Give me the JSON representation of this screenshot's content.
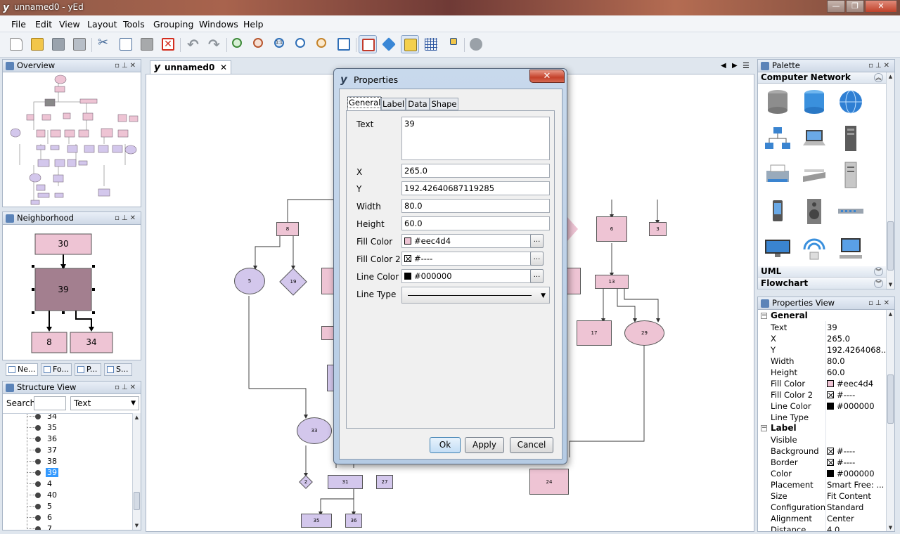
{
  "window": {
    "title": "unnamed0 - yEd"
  },
  "menu": [
    "File",
    "Edit",
    "View",
    "Layout",
    "Tools",
    "Grouping",
    "Windows",
    "Help"
  ],
  "toolbar": {
    "icons": [
      "new-document",
      "open",
      "save",
      "save-as",
      "cut",
      "copy",
      "paste",
      "delete",
      "undo",
      "redo",
      "zoom-in",
      "zoom-out",
      "zoom-100",
      "zoom-fit",
      "zoom-area",
      "fit-content",
      "edit-mode",
      "navigation-mode",
      "snapping",
      "grid",
      "orthogonal-edges",
      "plugin"
    ]
  },
  "panels": {
    "overview": {
      "title": "Overview"
    },
    "neighborhood": {
      "title": "Neighborhood",
      "nodes": {
        "top": "30",
        "center": "39",
        "bottom_left": "8",
        "bottom_right": "34"
      }
    },
    "tabs": [
      "Ne...",
      "Fo...",
      "P...",
      "S..."
    ],
    "structure": {
      "title": "Structure View",
      "search_label": "Search",
      "search_value": "",
      "filter": "Text",
      "items": [
        "34",
        "35",
        "36",
        "37",
        "38",
        "39",
        "4",
        "40",
        "5",
        "6",
        "7"
      ],
      "selected": "39"
    }
  },
  "editor": {
    "tab": "unnamed0"
  },
  "graph": {
    "nodes": [
      "8",
      "5",
      "19",
      "33",
      "2",
      "31",
      "35",
      "36",
      "27",
      "6",
      "3",
      "13",
      "17",
      "29",
      "24"
    ]
  },
  "dialog": {
    "title": "Properties",
    "tabs": [
      "General",
      "Label",
      "Data",
      "Shape"
    ],
    "fields": {
      "text_label": "Text",
      "text": "39",
      "x_label": "X",
      "x": "265.0",
      "y_label": "Y",
      "y": "192.42640687119285",
      "width_label": "Width",
      "width": "80.0",
      "height_label": "Height",
      "height": "60.0",
      "fill_label": "Fill Color",
      "fill": "#eec4d4",
      "fill2_label": "Fill Color 2",
      "fill2": "#----",
      "line_label": "Line Color",
      "line": "#000000",
      "linetype_label": "Line Type"
    },
    "buttons": {
      "ok": "Ok",
      "apply": "Apply",
      "cancel": "Cancel"
    }
  },
  "palette": {
    "title": "Palette",
    "sections": {
      "computer_network": "Computer Network",
      "uml": "UML",
      "flowchart": "Flowchart"
    },
    "icons": [
      "database-icon",
      "database-blue-icon",
      "globe-icon",
      "network-icon",
      "laptop-icon",
      "server-tower-icon",
      "printer-icon",
      "scanner-icon",
      "server-rack-icon",
      "mobile-phone-icon",
      "speaker-icon",
      "switch-icon",
      "monitor-icon",
      "wireless-icon",
      "workstation-icon"
    ]
  },
  "properties_view": {
    "title": "Properties View",
    "general_title": "General",
    "general": [
      {
        "k": "Text",
        "v": "39"
      },
      {
        "k": "X",
        "v": "265.0"
      },
      {
        "k": "Y",
        "v": "192.4264068..."
      },
      {
        "k": "Width",
        "v": "80.0"
      },
      {
        "k": "Height",
        "v": "60.0"
      },
      {
        "k": "Fill Color",
        "v": "#eec4d4"
      },
      {
        "k": "Fill Color 2",
        "v": "#----"
      },
      {
        "k": "Line Color",
        "v": "#000000"
      },
      {
        "k": "Line Type",
        "v": ""
      }
    ],
    "label_title": "Label",
    "label": [
      {
        "k": "Visible",
        "v": ""
      },
      {
        "k": "Background",
        "v": "#----"
      },
      {
        "k": "Border",
        "v": "#----"
      },
      {
        "k": "Color",
        "v": "#000000"
      },
      {
        "k": "Placement",
        "v": "Smart Free: ..."
      },
      {
        "k": "Size",
        "v": "Fit Content"
      },
      {
        "k": "Configuration",
        "v": "Standard"
      },
      {
        "k": "Alignment",
        "v": "Center"
      },
      {
        "k": "Distance",
        "v": "4.0"
      }
    ]
  },
  "colors": {
    "pink": "#eec4d4",
    "lavender": "#d3c7ec",
    "selected_node": "#a37f8f",
    "accent": "#3399ff"
  }
}
